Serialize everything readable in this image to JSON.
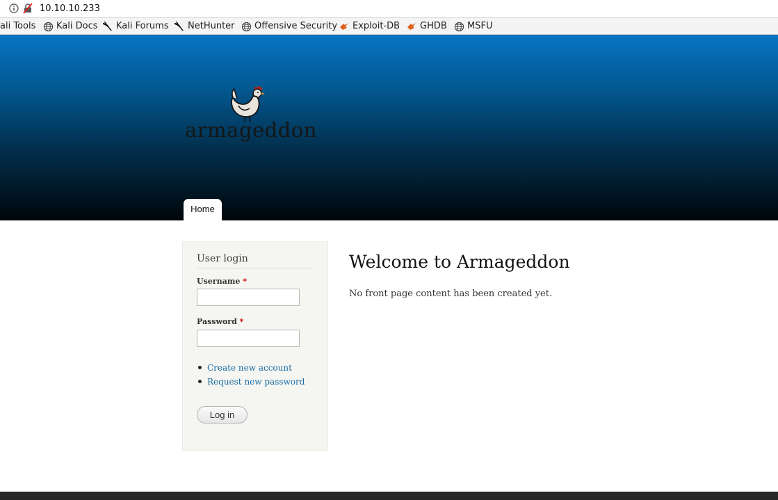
{
  "browser": {
    "url": "10.10.10.233",
    "bookmarks": [
      {
        "label": "ali Tools",
        "icon": "kali-icon"
      },
      {
        "label": "Kali Docs",
        "icon": "globe-icon"
      },
      {
        "label": "Kali Forums",
        "icon": "kali-dragon-icon"
      },
      {
        "label": "NetHunter",
        "icon": "kali-dragon-icon"
      },
      {
        "label": "Offensive Security",
        "icon": "globe-icon"
      },
      {
        "label": "Exploit-DB",
        "icon": "exploitdb-icon"
      },
      {
        "label": "GHDB",
        "icon": "exploitdb-icon"
      },
      {
        "label": "MSFU",
        "icon": "globe-icon"
      }
    ]
  },
  "site": {
    "name": "armageddon",
    "nav": {
      "home": "Home"
    }
  },
  "login": {
    "title": "User login",
    "username_label": "Username",
    "password_label": "Password",
    "required_marker": "*",
    "username_value": "",
    "password_value": "",
    "links": {
      "create": "Create new account",
      "request": "Request new password"
    },
    "submit": "Log in"
  },
  "main": {
    "title": "Welcome to Armageddon",
    "text": "No front page content has been created yet."
  },
  "colors": {
    "header_top": "#0774c4",
    "header_bottom": "#00060b",
    "link": "#1a6ea8",
    "required": "#cc0000",
    "footer": "#292929"
  }
}
